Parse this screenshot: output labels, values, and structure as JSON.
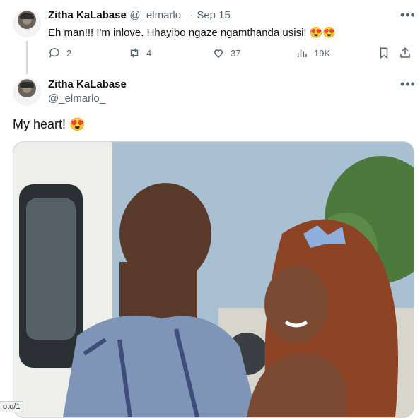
{
  "parent_tweet": {
    "name": "Zitha KaLabase",
    "handle": "@_elmarlo_",
    "separator": "·",
    "date": "Sep 15",
    "text": "Eh man!!! I'm inlove. Hhayibo ngaze ngamthanda usisi!",
    "emoji": "😍😍",
    "replies": "2",
    "retweets": "4",
    "likes": "37",
    "views": "19K"
  },
  "main_tweet": {
    "name": "Zitha KaLabase",
    "handle": "@_elmarlo_",
    "text": "My heart!",
    "emoji": "😍"
  },
  "icons": {
    "reply": "reply-icon",
    "retweet": "retweet-icon",
    "like": "heart-icon",
    "views": "views-icon",
    "bookmark": "bookmark-icon",
    "share": "share-icon",
    "more": "more-icon"
  },
  "status_bar": {
    "url_fragment": "oto/1"
  }
}
